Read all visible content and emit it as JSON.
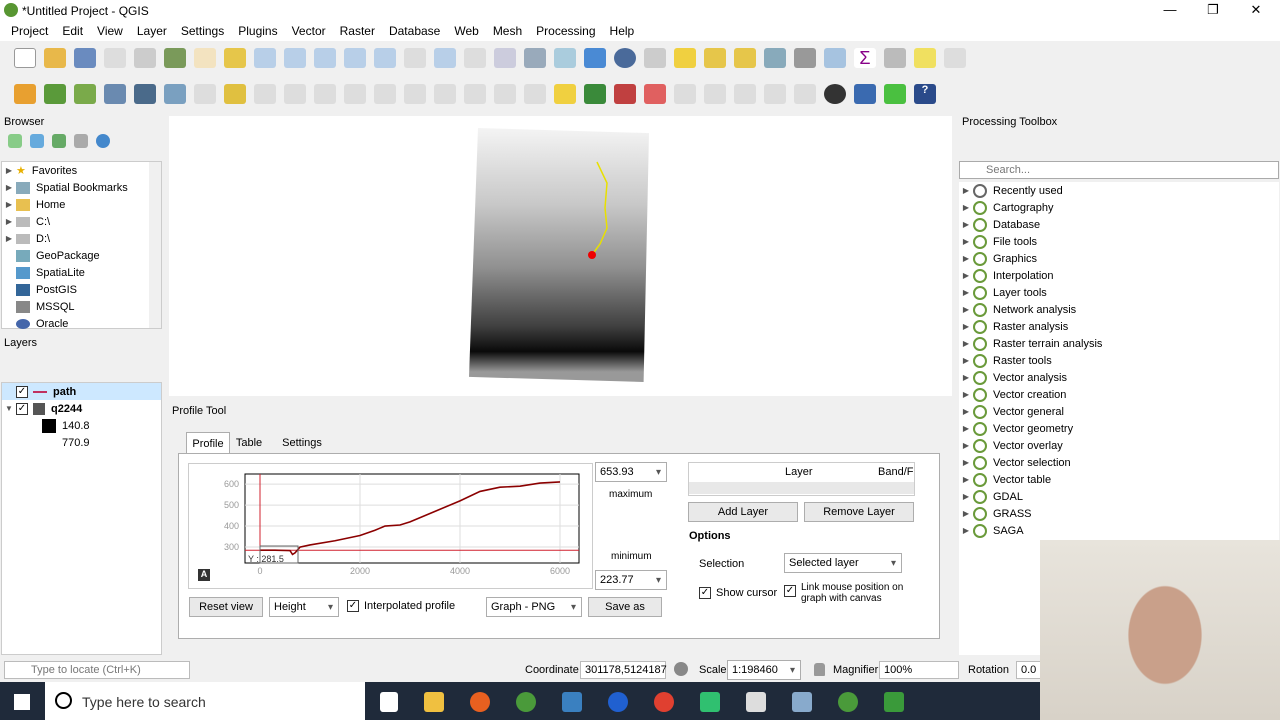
{
  "window": {
    "title": "*Untitled Project - QGIS",
    "min": "—",
    "max": "❐",
    "close": "✕"
  },
  "menu": [
    "Project",
    "Edit",
    "View",
    "Layer",
    "Settings",
    "Plugins",
    "Vector",
    "Raster",
    "Database",
    "Web",
    "Mesh",
    "Processing",
    "Help"
  ],
  "browser": {
    "title": "Browser",
    "items": [
      "Favorites",
      "Spatial Bookmarks",
      "Home",
      "C:\\",
      "D:\\",
      "GeoPackage",
      "SpatiaLite",
      "PostGIS",
      "MSSQL",
      "Oracle"
    ]
  },
  "layers": {
    "title": "Layers",
    "items": [
      {
        "name": "path"
      },
      {
        "name": "q2244"
      }
    ],
    "legend": [
      "140.8",
      "770.9"
    ]
  },
  "profile": {
    "title": "Profile Tool",
    "tabs": [
      "Profile",
      "Table",
      "Settings"
    ],
    "max_value": "653.93",
    "max_label": "maximum",
    "min_label": "minimum",
    "min_value": "223.77",
    "cursor_label": "Y : 281.5",
    "reset": "Reset view",
    "mode": "Height",
    "interpolated": "Interpolated profile",
    "export": "Graph - PNG",
    "save": "Save as",
    "table_headers": [
      "Layer",
      "Band/F"
    ],
    "add_layer": "Add Layer",
    "remove_layer": "Remove Layer",
    "options": "Options",
    "selection_label": "Selection",
    "selection_value": "Selected layer",
    "show_cursor": "Show cursor",
    "link_mouse": "Link mouse position on graph with canvas"
  },
  "chart_data": {
    "type": "line",
    "xlim": [
      -300,
      6380
    ],
    "ylim": [
      224,
      648
    ],
    "xticks": [
      0,
      2000,
      4000,
      6000
    ],
    "yticks": [
      300,
      400,
      500,
      600
    ],
    "xlabel": "",
    "ylabel": "",
    "grid": true,
    "x": [
      0,
      300,
      600,
      650,
      700,
      800,
      1000,
      1500,
      2000,
      2300,
      2500,
      2800,
      3000,
      3500,
      4000,
      4400,
      4800,
      5200,
      5600,
      6000
    ],
    "y": [
      285,
      285,
      283,
      265,
      272,
      300,
      310,
      330,
      355,
      380,
      400,
      405,
      420,
      470,
      520,
      565,
      585,
      590,
      605,
      610
    ],
    "reference_line": 285
  },
  "toolbox": {
    "title": "Processing Toolbox",
    "search_placeholder": "Search...",
    "items": [
      "Recently used",
      "Cartography",
      "Database",
      "File tools",
      "Graphics",
      "Interpolation",
      "Layer tools",
      "Network analysis",
      "Raster analysis",
      "Raster terrain analysis",
      "Raster tools",
      "Vector analysis",
      "Vector creation",
      "Vector general",
      "Vector geometry",
      "Vector overlay",
      "Vector selection",
      "Vector table",
      "GDAL",
      "GRASS",
      "SAGA"
    ]
  },
  "status": {
    "locate_placeholder": "Type to locate (Ctrl+K)",
    "coord_label": "Coordinate",
    "coord": "301178,5124187",
    "scale_label": "Scale",
    "scale": "1:198460",
    "magnifier_label": "Magnifier",
    "magnifier": "100%",
    "rotation_label": "Rotation",
    "rotation": "0.0 °"
  },
  "taskbar": {
    "search": "Type here to search"
  },
  "colors": {
    "accent": "#589632",
    "profile": "#8b0000",
    "ref": "#d0202e"
  }
}
